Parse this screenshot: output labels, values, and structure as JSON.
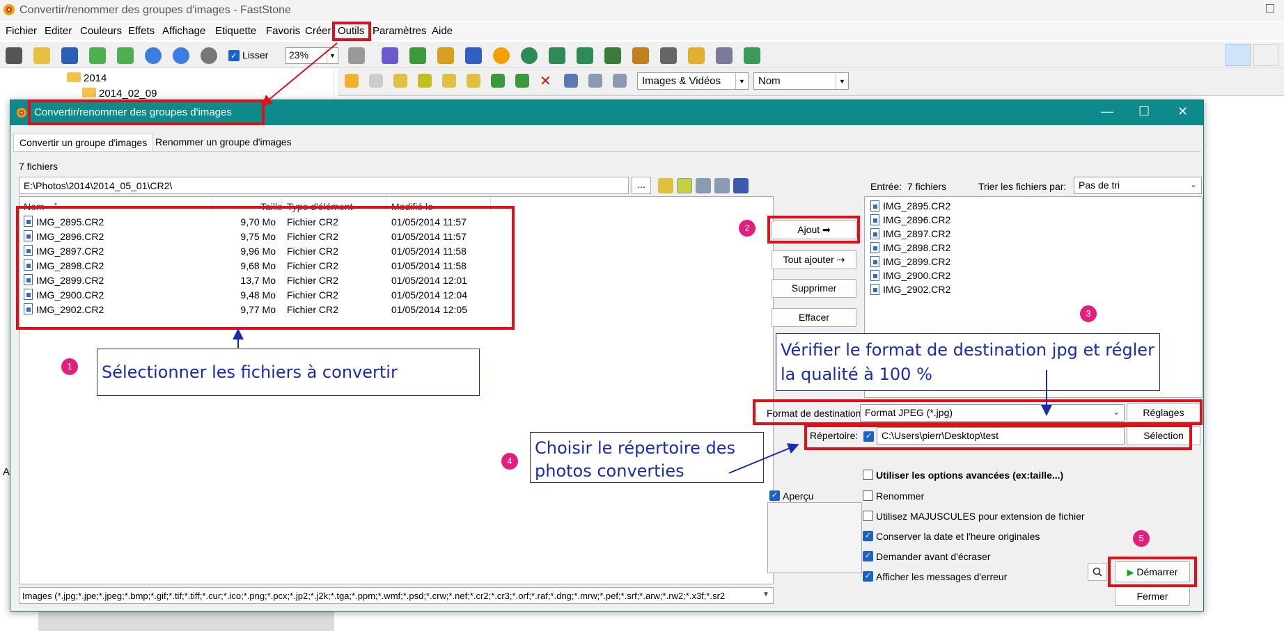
{
  "app": {
    "title": "Convertir/renommer des groupes d'images - FastStone",
    "menu": [
      "Fichier",
      "Editer",
      "Couleurs",
      "Effets",
      "Affichage",
      "Etiquette",
      "Favoris",
      "Créer",
      "Outils",
      "Paramètres",
      "Aide"
    ],
    "toolbar": {
      "lisser_label": "Lisser",
      "zoom_value": "23%"
    },
    "tree": {
      "folder_year": "2014",
      "folder_date": "2014_02_09"
    },
    "filter_combo": "Images & Vidéos",
    "sort_combo": "Nom",
    "side_letter": "A"
  },
  "dialog": {
    "title": "Convertir/renommer des groupes d'images",
    "tabs": [
      "Convertir un groupe d'images",
      "Renommer un groupe d'images"
    ],
    "file_count": "7 fichiers",
    "path": "E:\\Photos\\2014\\2014_05_01\\CR2\\",
    "browse_label": "...",
    "columns": {
      "name": "Nom",
      "size": "Taille",
      "type": "Type d'élément",
      "modified": "Modifié le"
    },
    "files": [
      {
        "name": "IMG_2895.CR2",
        "size": "9,70 Mo",
        "type": "Fichier CR2",
        "modified": "01/05/2014 11:57"
      },
      {
        "name": "IMG_2896.CR2",
        "size": "9,75 Mo",
        "type": "Fichier CR2",
        "modified": "01/05/2014 11:57"
      },
      {
        "name": "IMG_2897.CR2",
        "size": "9,96 Mo",
        "type": "Fichier CR2",
        "modified": "01/05/2014 11:58"
      },
      {
        "name": "IMG_2898.CR2",
        "size": "9,68 Mo",
        "type": "Fichier CR2",
        "modified": "01/05/2014 11:58"
      },
      {
        "name": "IMG_2899.CR2",
        "size": "13,7 Mo",
        "type": "Fichier CR2",
        "modified": "01/05/2014 12:01"
      },
      {
        "name": "IMG_2900.CR2",
        "size": "9,48 Mo",
        "type": "Fichier CR2",
        "modified": "01/05/2014 12:04"
      },
      {
        "name": "IMG_2902.CR2",
        "size": "9,77 Mo",
        "type": "Fichier CR2",
        "modified": "01/05/2014 12:05"
      }
    ],
    "filter": "Images (*.jpg;*.jpe;*.jpeg;*.bmp;*.gif;*.tif;*.tiff;*.cur;*.ico;*.png;*.pcx;*.jp2;*.j2k;*.tga;*.ppm;*.wmf;*.psd;*.crw;*.nef;*.cr2;*.cr3;*.orf;*.raf;*.dng;*.mrw;*.pef;*.srf;*.arw;*.rw2;*.x3f;*.sr2",
    "buttons": {
      "add": "Ajout ➡",
      "add_all": "Tout ajouter ⇢",
      "remove": "Supprimer",
      "clear": "Effacer",
      "settings": "Réglages",
      "selection": "Sélection",
      "start": "Démarrer",
      "close": "Fermer"
    },
    "input": {
      "label": "Entrée:",
      "count": "7 fichiers",
      "sort_label": "Trier les fichiers par:",
      "sort_value": "Pas de tri"
    },
    "input_files": [
      "IMG_2895.CR2",
      "IMG_2896.CR2",
      "IMG_2897.CR2",
      "IMG_2898.CR2",
      "IMG_2899.CR2",
      "IMG_2900.CR2",
      "IMG_2902.CR2"
    ],
    "format_label": "Format de destination:",
    "format_value": "Format JPEG (*.jpg)",
    "folder_label": "Répertoire:",
    "folder_value": "C:\\Users\\pierr\\Desktop\\test",
    "preview_label": "Aperçu",
    "options": [
      {
        "label": "Utiliser les options avancées (ex:taille...)",
        "checked": false
      },
      {
        "label": "Renommer",
        "checked": false
      },
      {
        "label": "Utilisez MAJUSCULES pour extension de fichier",
        "checked": false
      },
      {
        "label": "Conserver la date et l'heure originales",
        "checked": true
      },
      {
        "label": "Demander avant d'écraser",
        "checked": true
      },
      {
        "label": "Afficher les messages d'erreur",
        "checked": true
      }
    ]
  },
  "annotations": {
    "badges": [
      "1",
      "2",
      "3",
      "4",
      "5"
    ],
    "note1": "Sélectionner les fichiers à convertir",
    "note3": "Vérifier le format de destination jpg et régler la qualité  à 100 %",
    "note4": "Choisir le répertoire des photos converties",
    "color_box": "#e0101a",
    "color_badge": "#e51d7c",
    "color_note": "#1a2bb0"
  },
  "colors": {
    "dialog_title": "#0e8a8a",
    "check": "#1a62c7",
    "start_arrow": "#1aa11a"
  }
}
